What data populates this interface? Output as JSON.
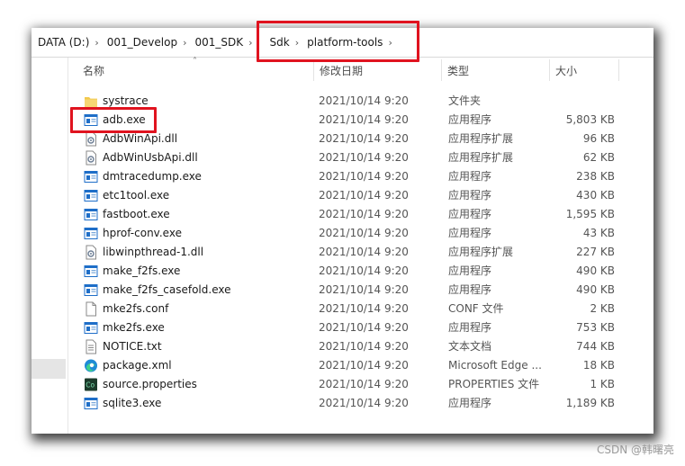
{
  "breadcrumb": [
    "DATA (D:)",
    "001_Develop",
    "001_SDK",
    "Sdk",
    "platform-tools"
  ],
  "columns": {
    "name": "名称",
    "date": "修改日期",
    "type": "类型",
    "size": "大小"
  },
  "files": [
    {
      "name": "systrace",
      "date": "2021/10/14 9:20",
      "type": "文件夹",
      "size": "",
      "icon": "folder-icon"
    },
    {
      "name": "adb.exe",
      "date": "2021/10/14 9:20",
      "type": "应用程序",
      "size": "5,803 KB",
      "icon": "exe-icon"
    },
    {
      "name": "AdbWinApi.dll",
      "date": "2021/10/14 9:20",
      "type": "应用程序扩展",
      "size": "96 KB",
      "icon": "dll-icon"
    },
    {
      "name": "AdbWinUsbApi.dll",
      "date": "2021/10/14 9:20",
      "type": "应用程序扩展",
      "size": "62 KB",
      "icon": "dll-icon"
    },
    {
      "name": "dmtracedump.exe",
      "date": "2021/10/14 9:20",
      "type": "应用程序",
      "size": "238 KB",
      "icon": "exe-icon"
    },
    {
      "name": "etc1tool.exe",
      "date": "2021/10/14 9:20",
      "type": "应用程序",
      "size": "430 KB",
      "icon": "exe-icon"
    },
    {
      "name": "fastboot.exe",
      "date": "2021/10/14 9:20",
      "type": "应用程序",
      "size": "1,595 KB",
      "icon": "exe-icon"
    },
    {
      "name": "hprof-conv.exe",
      "date": "2021/10/14 9:20",
      "type": "应用程序",
      "size": "43 KB",
      "icon": "exe-icon"
    },
    {
      "name": "libwinpthread-1.dll",
      "date": "2021/10/14 9:20",
      "type": "应用程序扩展",
      "size": "227 KB",
      "icon": "dll-icon"
    },
    {
      "name": "make_f2fs.exe",
      "date": "2021/10/14 9:20",
      "type": "应用程序",
      "size": "490 KB",
      "icon": "exe-icon"
    },
    {
      "name": "make_f2fs_casefold.exe",
      "date": "2021/10/14 9:20",
      "type": "应用程序",
      "size": "490 KB",
      "icon": "exe-icon"
    },
    {
      "name": "mke2fs.conf",
      "date": "2021/10/14 9:20",
      "type": "CONF 文件",
      "size": "2 KB",
      "icon": "file-icon"
    },
    {
      "name": "mke2fs.exe",
      "date": "2021/10/14 9:20",
      "type": "应用程序",
      "size": "753 KB",
      "icon": "exe-icon"
    },
    {
      "name": "NOTICE.txt",
      "date": "2021/10/14 9:20",
      "type": "文本文档",
      "size": "744 KB",
      "icon": "txt-icon"
    },
    {
      "name": "package.xml",
      "date": "2021/10/14 9:20",
      "type": "Microsoft Edge ...",
      "size": "18 KB",
      "icon": "edge-icon"
    },
    {
      "name": "source.properties",
      "date": "2021/10/14 9:20",
      "type": "PROPERTIES 文件",
      "size": "1 KB",
      "icon": "properties-icon"
    },
    {
      "name": "sqlite3.exe",
      "date": "2021/10/14 9:20",
      "type": "应用程序",
      "size": "1,189 KB",
      "icon": "exe-icon"
    }
  ],
  "watermark": "CSDN @韩曙亮",
  "colors": {
    "highlight": "#e0131f",
    "folder": "#f2c94c",
    "exe": "#1e6ec8",
    "edge": "#1f8bd6"
  }
}
